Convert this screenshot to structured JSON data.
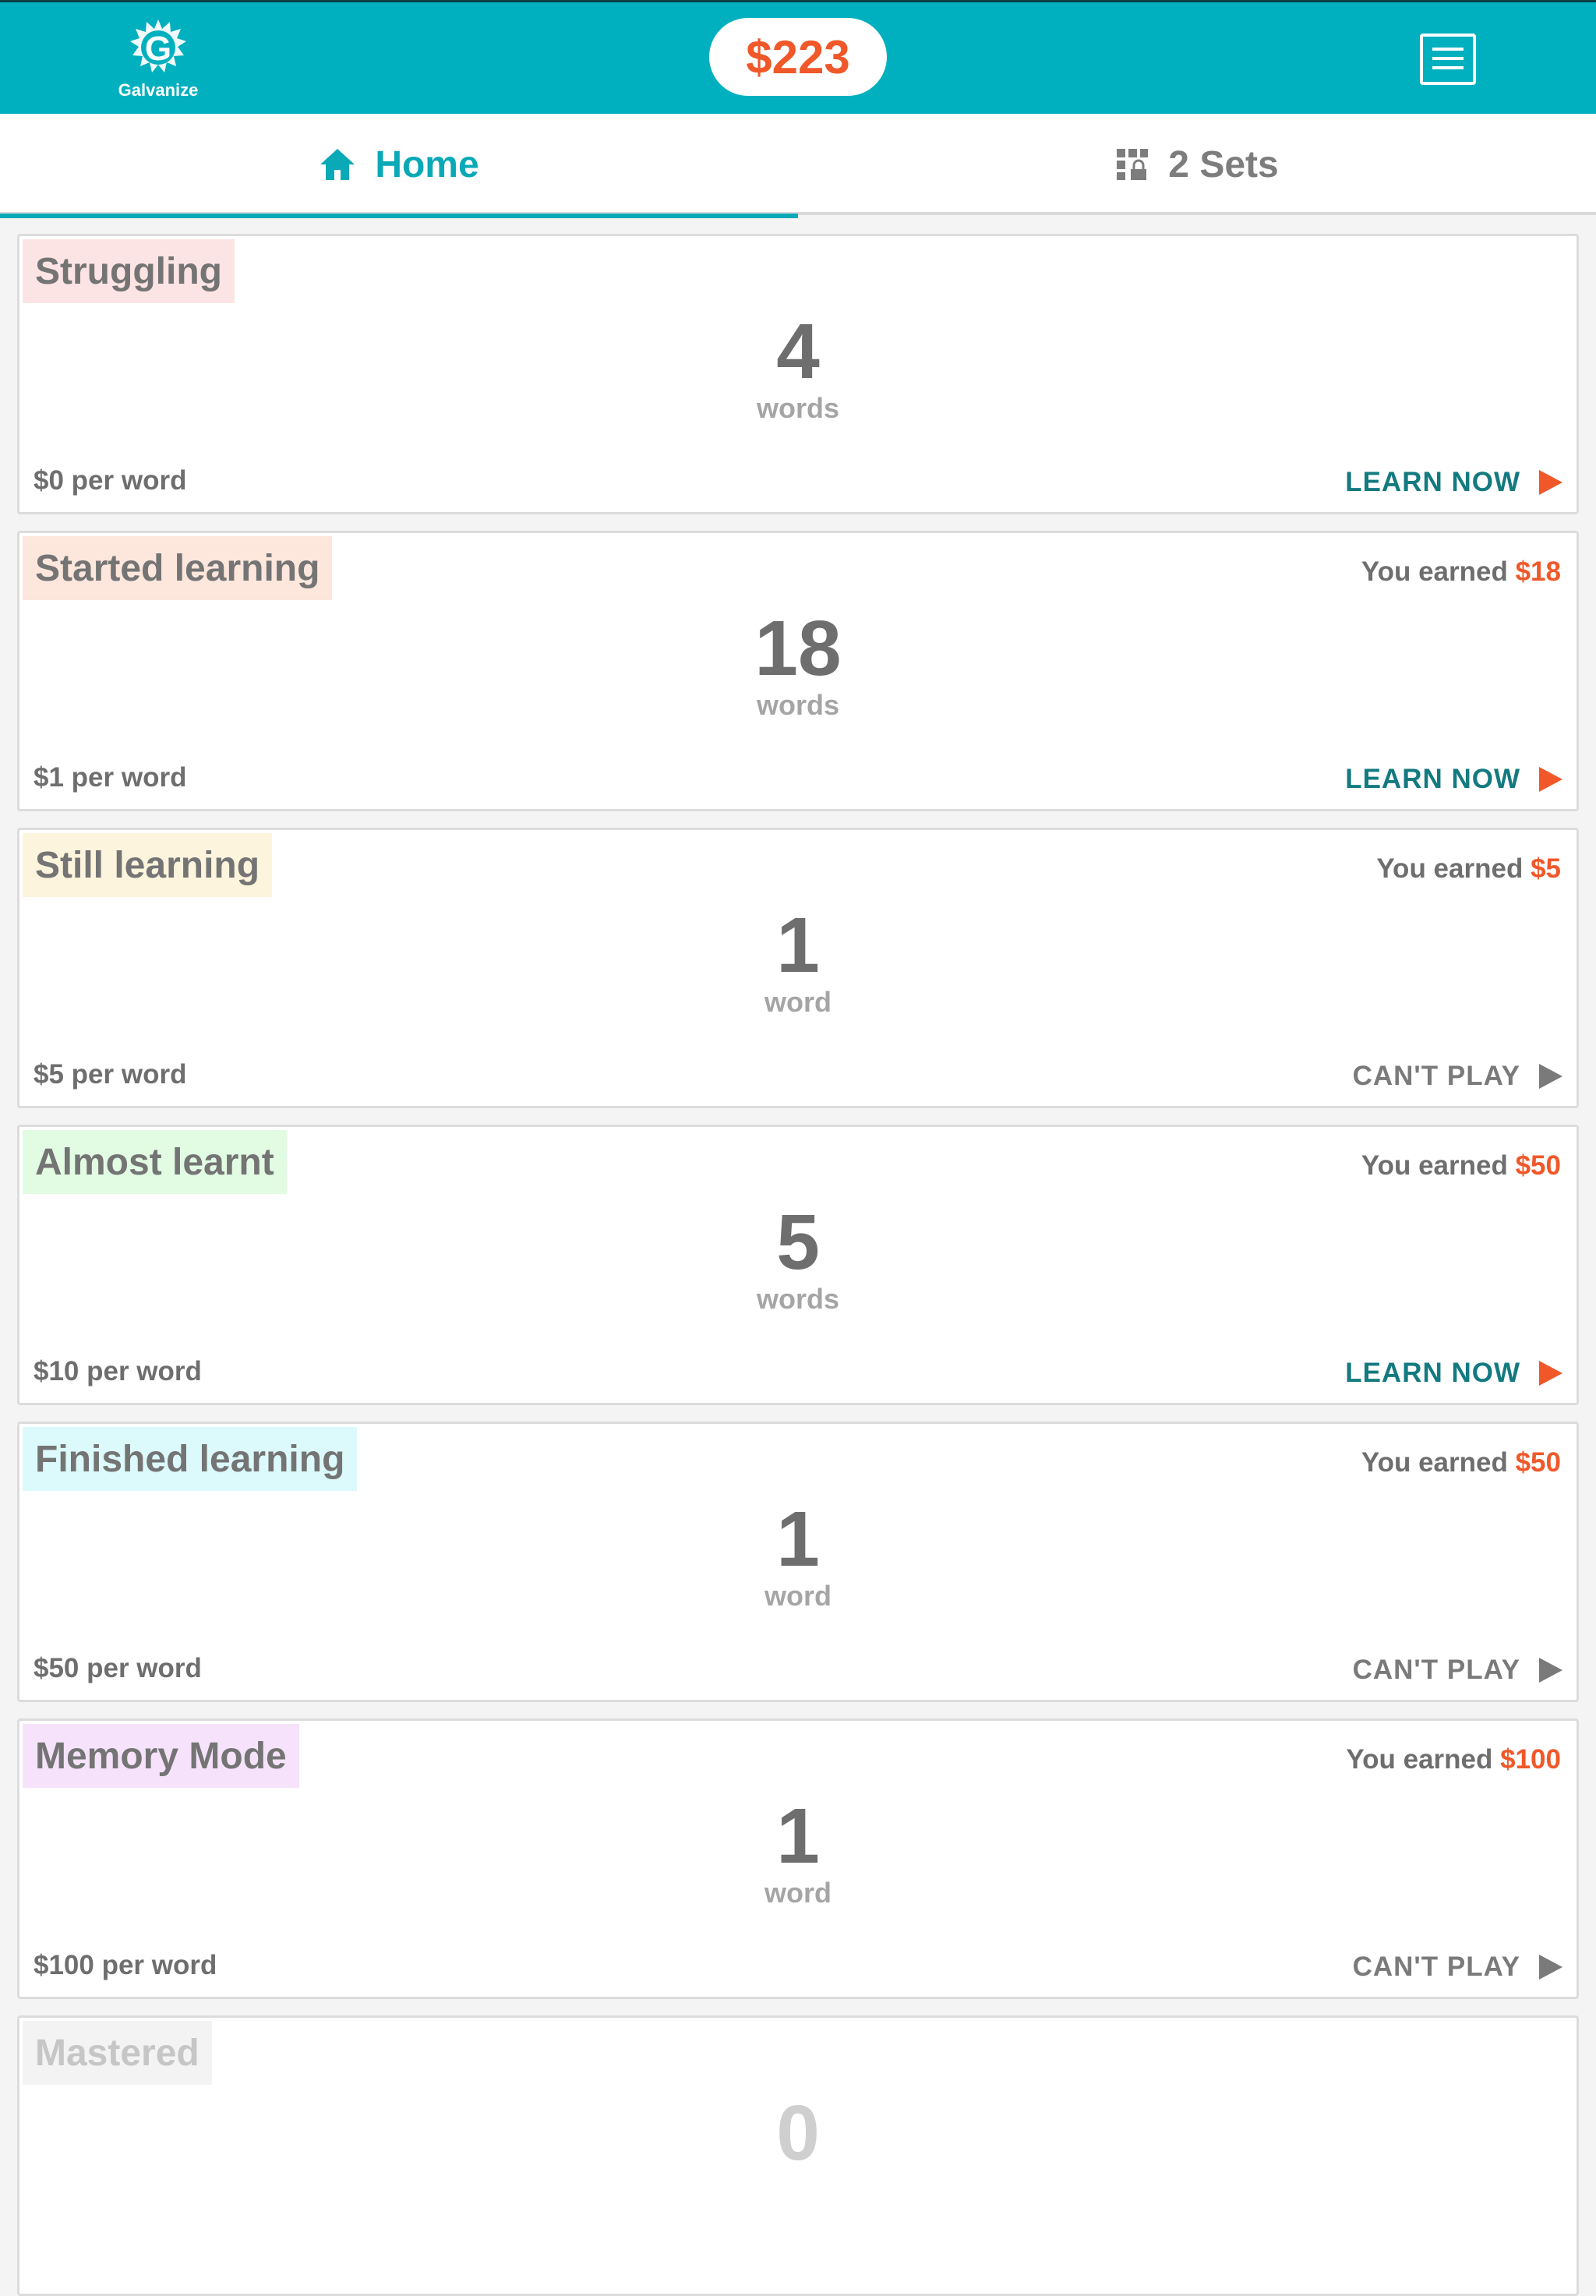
{
  "header": {
    "logo_text": "Galvanize",
    "balance": "$223"
  },
  "tabs": [
    {
      "label": "Home",
      "icon": "home-icon",
      "active": true
    },
    {
      "label": "2 Sets",
      "icon": "grid-lock-icon",
      "active": false
    }
  ],
  "colors": {
    "brand": "#00b0bf",
    "accent": "#f0582a",
    "learn_action": "#137a80"
  },
  "cards": [
    {
      "label": "Struggling",
      "label_bg": "#fde4e4",
      "earned_text": "",
      "earned_amount": "",
      "count": "4",
      "unit": "words",
      "rate": "$0 per word",
      "action": "LEARN NOW",
      "action_enabled": true
    },
    {
      "label": "Started learning",
      "label_bg": "#fde6dc",
      "earned_text": "You earned",
      "earned_amount": "$18",
      "count": "18",
      "unit": "words",
      "rate": "$1 per word",
      "action": "LEARN NOW",
      "action_enabled": true
    },
    {
      "label": "Still learning",
      "label_bg": "#fdf4dd",
      "earned_text": "You earned",
      "earned_amount": "$5",
      "count": "1",
      "unit": "word",
      "rate": "$5 per word",
      "action": "CAN'T PLAY",
      "action_enabled": false
    },
    {
      "label": "Almost learnt",
      "label_bg": "#e2fbe3",
      "earned_text": "You earned",
      "earned_amount": "$50",
      "count": "5",
      "unit": "words",
      "rate": "$10 per word",
      "action": "LEARN NOW",
      "action_enabled": true
    },
    {
      "label": "Finished learning",
      "label_bg": "#dcfafb",
      "earned_text": "You earned",
      "earned_amount": "$50",
      "count": "1",
      "unit": "word",
      "rate": "$50 per word",
      "action": "CAN'T PLAY",
      "action_enabled": false
    },
    {
      "label": "Memory Mode",
      "label_bg": "#f6e3fb",
      "earned_text": "You earned",
      "earned_amount": "$100",
      "count": "1",
      "unit": "word",
      "rate": "$100 per word",
      "action": "CAN'T PLAY",
      "action_enabled": false
    },
    {
      "label": "Mastered",
      "label_bg": "#f3f3f3",
      "earned_text": "",
      "earned_amount": "",
      "count": "0",
      "unit": "",
      "rate": "",
      "action": "",
      "action_enabled": false
    }
  ]
}
